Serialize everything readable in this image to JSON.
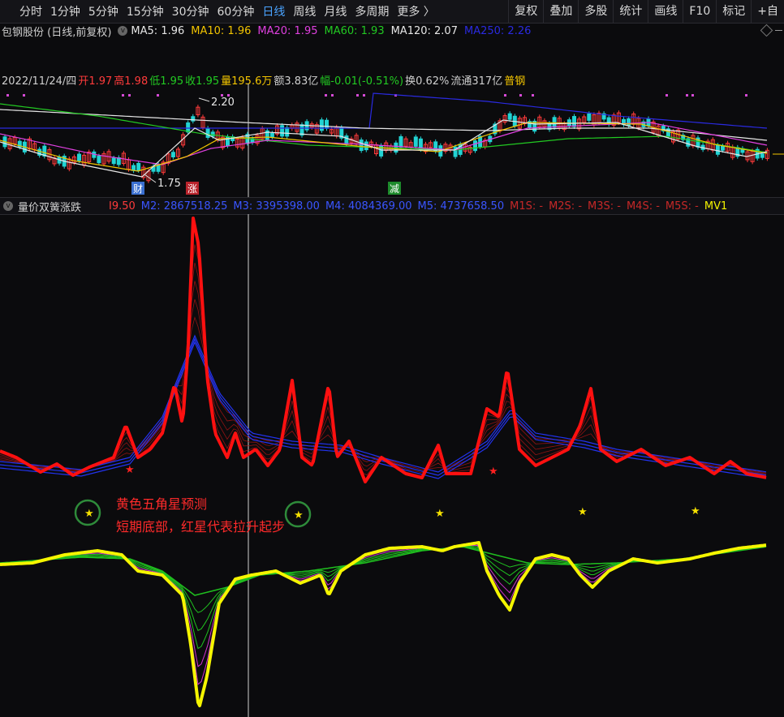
{
  "toolbar": {
    "tabs": [
      "分时",
      "1分钟",
      "5分钟",
      "15分钟",
      "30分钟",
      "60分钟",
      "日线",
      "周线",
      "月线",
      "多周期",
      "更多 〉"
    ],
    "active_tab": "日线",
    "tools": [
      "复权",
      "叠加",
      "多股",
      "统计",
      "画线",
      "F10",
      "标记",
      "+自"
    ]
  },
  "info": {
    "stock": "包钢股份 (日线,前复权)",
    "ma": [
      {
        "label": "MA5: 1.96",
        "color": "#e6e6e6"
      },
      {
        "label": "MA10: 1.96",
        "color": "#f2c400"
      },
      {
        "label": "MA20: 1.95",
        "color": "#e040e0"
      },
      {
        "label": "MA60: 1.93",
        "color": "#22c922"
      },
      {
        "label": "MA120: 2.07",
        "color": "#e6e6e6"
      },
      {
        "label": "MA250: 2.26",
        "color": "#2a2ae0"
      }
    ]
  },
  "ohlc": [
    {
      "t": "2022/11/24/四",
      "c": "#cfcfcf"
    },
    {
      "t": "开1.97",
      "c": "#ff3b3b"
    },
    {
      "t": "高1.98",
      "c": "#ff3b3b"
    },
    {
      "t": "低1.95",
      "c": "#22c922"
    },
    {
      "t": "收1.95",
      "c": "#22c922"
    },
    {
      "t": "量195.6万",
      "c": "#f2c400"
    },
    {
      "t": "额3.83亿",
      "c": "#cfcfcf"
    },
    {
      "t": "幅-0.01(-0.51%)",
      "c": "#22c922"
    },
    {
      "t": "换0.62%",
      "c": "#cfcfcf"
    },
    {
      "t": "流通317亿",
      "c": "#cfcfcf"
    },
    {
      "t": "普钢",
      "c": "#f2c400"
    }
  ],
  "price_labels": {
    "high": "2.20",
    "low": "1.75"
  },
  "event_badges": [
    {
      "text": "财",
      "color": "#3a6fd0"
    },
    {
      "text": "涨",
      "color": "#b8232b"
    },
    {
      "text": "减",
      "color": "#1d8a2b"
    }
  ],
  "indicator": {
    "name": "量价双簧涨跌",
    "values": [
      {
        "t": "I9.50",
        "c": "#ff3b3b"
      },
      {
        "t": "M2: 2867518.25",
        "c": "#3a55ff"
      },
      {
        "t": "M3: 3395398.00",
        "c": "#3a55ff"
      },
      {
        "t": "M4: 4084369.00",
        "c": "#3a55ff"
      },
      {
        "t": "M5: 4737658.50",
        "c": "#3a55ff"
      },
      {
        "t": "M1S: -",
        "c": "#c62828"
      },
      {
        "t": "M2S: -",
        "c": "#c62828"
      },
      {
        "t": "M3S: -",
        "c": "#c62828"
      },
      {
        "t": "M4S: -",
        "c": "#c62828"
      },
      {
        "t": "M5S: -",
        "c": "#c62828"
      },
      {
        "t": "MV1",
        "c": "#f2f200"
      }
    ]
  },
  "annotation": {
    "line1": "黄色五角星预测",
    "line2": "短期底部，红星代表拉升起步"
  },
  "colors": {
    "up": "#ff3b3b",
    "down": "#22d3d3",
    "red_line": "#ff1010",
    "yellow_line": "#f5f500"
  }
}
